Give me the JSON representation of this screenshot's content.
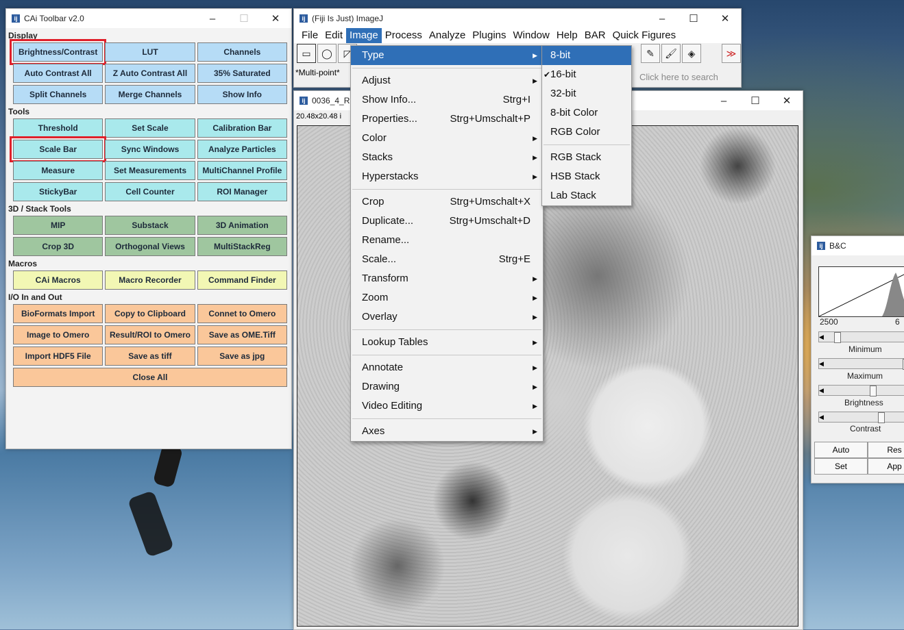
{
  "cai_toolbar": {
    "title": "CAi Toolbar v2.0",
    "window_controls": [
      "–",
      "☐",
      "✕"
    ],
    "sections": [
      {
        "label": "Display",
        "color": "#b6dcf6",
        "rows": [
          [
            "Brightness/Contrast",
            "LUT",
            "Channels"
          ],
          [
            "Auto Contrast All",
            "Z Auto Contrast All",
            "35% Saturated"
          ],
          [
            "Split Channels",
            "Merge Channels",
            "Show Info"
          ]
        ]
      },
      {
        "label": "Tools",
        "color": "#a9e9ec",
        "rows": [
          [
            "Threshold",
            "Set Scale",
            "Calibration Bar"
          ],
          [
            "Scale Bar",
            "Sync Windows",
            "Analyze Particles"
          ],
          [
            "Measure",
            "Set Measurements",
            "MultiChannel Profile"
          ],
          [
            "StickyBar",
            "Cell Counter",
            "ROI Manager"
          ]
        ]
      },
      {
        "label": "3D / Stack Tools",
        "color": "#9fc69f",
        "rows": [
          [
            "MIP",
            "Substack",
            "3D Animation"
          ],
          [
            "Crop 3D",
            "Orthogonal Views",
            "MultiStackReg"
          ]
        ]
      },
      {
        "label": "Macros",
        "color": "#f2f7b4",
        "rows": [
          [
            "CAi Macros",
            "Macro Recorder",
            "Command Finder"
          ]
        ]
      },
      {
        "label": "I/O In and Out",
        "color": "#fac79a",
        "rows": [
          [
            "BioFormats Import",
            "Copy to Clipboard",
            "Connet to Omero"
          ],
          [
            "Image to Omero",
            "Result/ROI to Omero",
            "Save as OME.Tiff"
          ],
          [
            "Import HDF5 File",
            "Save as tiff",
            "Save as jpg"
          ]
        ]
      }
    ],
    "close_all": "Close All"
  },
  "fiji": {
    "title": "(Fiji Is Just) ImageJ",
    "menus": [
      "File",
      "Edit",
      "Image",
      "Process",
      "Analyze",
      "Plugins",
      "Window",
      "Help",
      "BAR",
      "Quick Figures"
    ],
    "status": "*Multi-point*",
    "search_placeholder": "Click here to search",
    "tool_icons": [
      "rectangle-icon",
      "oval-icon",
      "polygon-icon",
      "pencil-icon",
      "brush-icon",
      "flood-fill-icon",
      "more-tools-icon"
    ]
  },
  "image_window": {
    "title": "0036_4_R",
    "meta": "20.48x20.48 i"
  },
  "image_menu": {
    "items": [
      {
        "label": "Type",
        "shortcut": "",
        "submenu": true,
        "active": true
      },
      {
        "sep": true
      },
      {
        "label": "Adjust",
        "shortcut": "",
        "submenu": true
      },
      {
        "label": "Show Info...",
        "shortcut": "Strg+I"
      },
      {
        "label": "Properties...",
        "shortcut": "Strg+Umschalt+P"
      },
      {
        "label": "Color",
        "shortcut": "",
        "submenu": true
      },
      {
        "label": "Stacks",
        "shortcut": "",
        "submenu": true
      },
      {
        "label": "Hyperstacks",
        "shortcut": "",
        "submenu": true
      },
      {
        "sep": true
      },
      {
        "label": "Crop",
        "shortcut": "Strg+Umschalt+X"
      },
      {
        "label": "Duplicate...",
        "shortcut": "Strg+Umschalt+D"
      },
      {
        "label": "Rename...",
        "shortcut": ""
      },
      {
        "label": "Scale...",
        "shortcut": "Strg+E"
      },
      {
        "label": "Transform",
        "shortcut": "",
        "submenu": true
      },
      {
        "label": "Zoom",
        "shortcut": "",
        "submenu": true
      },
      {
        "label": "Overlay",
        "shortcut": "",
        "submenu": true
      },
      {
        "sep": true
      },
      {
        "label": "Lookup Tables",
        "shortcut": "",
        "submenu": true
      },
      {
        "sep": true
      },
      {
        "label": "Annotate",
        "shortcut": "",
        "submenu": true
      },
      {
        "label": "Drawing",
        "shortcut": "",
        "submenu": true
      },
      {
        "label": "Video Editing",
        "shortcut": "",
        "submenu": true
      },
      {
        "sep": true
      },
      {
        "label": "Axes",
        "shortcut": "",
        "submenu": true
      }
    ]
  },
  "type_menu": {
    "items": [
      {
        "label": "8-bit",
        "active": true
      },
      {
        "label": "16-bit",
        "checked": true
      },
      {
        "label": "32-bit"
      },
      {
        "label": "8-bit Color"
      },
      {
        "label": "RGB Color"
      },
      {
        "sep": true
      },
      {
        "label": "RGB Stack"
      },
      {
        "label": "HSB Stack"
      },
      {
        "label": "Lab Stack"
      }
    ]
  },
  "bc": {
    "title": "B&C",
    "hist_min_label": "2500",
    "hist_max_label": "6",
    "minimum": "Minimum",
    "maximum": "Maximum",
    "brightness": "Brightness",
    "contrast": "Contrast",
    "buttons": [
      "Auto",
      "Res",
      "Set",
      "App"
    ]
  },
  "colors": {
    "highlight": "#e0202a",
    "menu_active": "#2f6fb7"
  }
}
